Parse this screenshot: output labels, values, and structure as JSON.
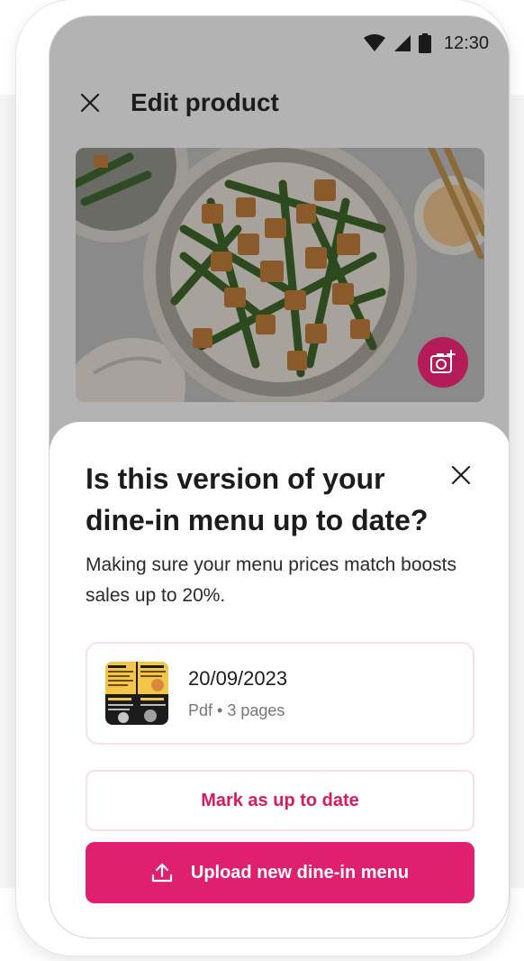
{
  "status_bar": {
    "time": "12:30",
    "icons": [
      "wifi-icon",
      "cellular-signal-icon",
      "battery-icon"
    ]
  },
  "header": {
    "title": "Edit product",
    "close_icon": "close-icon"
  },
  "product": {
    "image_alt": "product-photo",
    "camera_button_icon": "add-photo-icon"
  },
  "sheet": {
    "title": "Is this version of your dine-in menu up to date?",
    "description": "Making sure your menu prices match boosts sales up to 20%.",
    "close_icon": "close-icon",
    "file": {
      "date": "20/09/2023",
      "meta": "Pdf • 3 pages"
    },
    "secondary_button": "Mark as up to date",
    "primary_button": "Upload new dine-in menu",
    "primary_button_icon": "upload-icon"
  },
  "colors": {
    "accent": "#e0206e",
    "accent_text": "#d81b60",
    "camera_button": "#b31b59",
    "overlay": "#b3b3b3"
  }
}
